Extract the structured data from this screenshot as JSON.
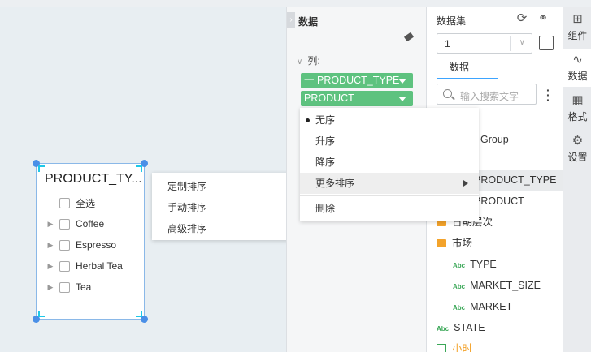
{
  "canvas": {
    "widget": {
      "title": "PRODUCT_TY...",
      "items": [
        {
          "label": "全选",
          "expandable": false
        },
        {
          "label": "Coffee",
          "expandable": true
        },
        {
          "label": "Espresso",
          "expandable": true
        },
        {
          "label": "Herbal Tea",
          "expandable": true
        },
        {
          "label": "Tea",
          "expandable": true
        }
      ]
    },
    "sort_submenu": [
      "定制排序",
      "手动排序",
      "高级排序"
    ]
  },
  "data_panel": {
    "title": "数据",
    "section": "列:",
    "columns": [
      {
        "label": "PRODUCT_TYPE",
        "prefix": "一 "
      },
      {
        "label": "PRODUCT",
        "prefix": ""
      }
    ],
    "menu": {
      "items": [
        "无序",
        "升序",
        "降序",
        "更多排序",
        "删除"
      ],
      "selected": "无序",
      "highlighted": "更多排序"
    }
  },
  "dataset": {
    "title": "数据集",
    "select_value": "1",
    "tab": "数据",
    "search_placeholder": "输入搜索文字",
    "fields": [
      {
        "label": "Group",
        "type": "hidden-partial"
      },
      {
        "label": "PRODUCT_TYPE",
        "type": "dimension",
        "selected": true
      },
      {
        "label": "PRODUCT",
        "type": "dimension"
      },
      {
        "label": "日期层次",
        "type": "folder"
      },
      {
        "label": "市场",
        "type": "folder"
      },
      {
        "label": "TYPE",
        "type": "abc",
        "indent": true
      },
      {
        "label": "MARKET_SIZE",
        "type": "abc",
        "indent": true
      },
      {
        "label": "MARKET",
        "type": "abc",
        "indent": true
      },
      {
        "label": "STATE",
        "type": "abc"
      },
      {
        "label": "小时",
        "type": "date"
      }
    ]
  },
  "iconbar": [
    {
      "label": "组件",
      "icon": "component-icon"
    },
    {
      "label": "数据",
      "icon": "data-icon",
      "active": true
    },
    {
      "label": "格式",
      "icon": "format-icon"
    },
    {
      "label": "设置",
      "icon": "settings-icon"
    }
  ],
  "colors": {
    "pill": "#5ec27f",
    "accent": "#3da4ff",
    "folder": "#f3a32b",
    "abc": "#3aa757"
  }
}
